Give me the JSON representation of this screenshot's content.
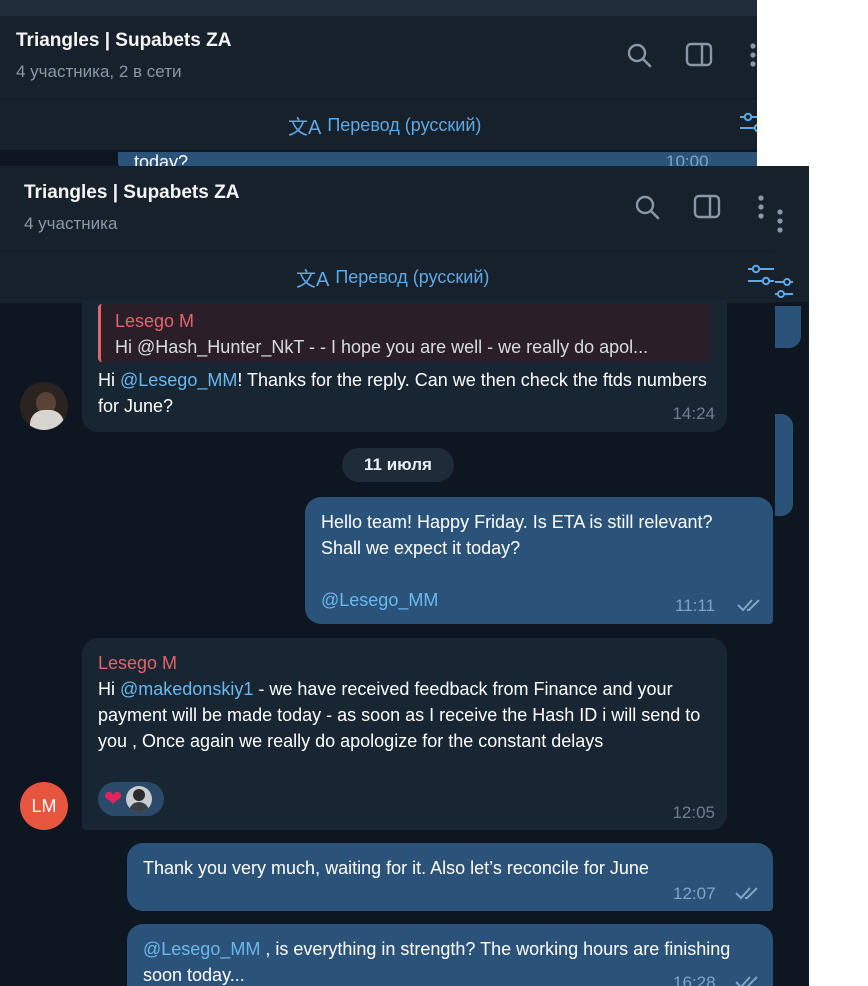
{
  "back_window": {
    "title": "Triangles | Supabets ZA",
    "subtitle": "4 участника, 2 в сети",
    "translate_label": "Перевод (русский)",
    "peek_text": "today?",
    "peek_time": "10:00"
  },
  "front_window": {
    "title": "Triangles | Supabets ZA",
    "subtitle": "4 участника",
    "translate_label": "Перевод (русский)"
  },
  "icons": {
    "search": "search-icon",
    "sidebar": "sidebar-toggle-icon",
    "menu": "more-vertical-icon",
    "filter": "translate-settings-icon",
    "translate": "translate-icon"
  },
  "colors": {
    "bg": "#0e1621",
    "header": "#17212b",
    "incoming": "#182533",
    "outgoing": "#2b5278",
    "link": "#6bb8ee",
    "sender": "#e5646a",
    "accent": "#5fa8e8",
    "avatar_lm": "#e8553f"
  },
  "messages": [
    {
      "reply_name": "Lesego M",
      "reply_text": "Hi @Hash_Hunter_NkT - - I hope you are well - we really do apol...",
      "pre": "Hi ",
      "mention": "@Lesego_MM",
      "post": "! Thanks for the reply. Can we then check the ftds numbers for June?",
      "time": "14:24"
    },
    {
      "text": "Hello team! Happy Friday. Is ETA is still relevant? Shall we expect it today?",
      "mention": "@Lesego_MM",
      "time": "11:11"
    },
    {
      "sender": "Lesego M",
      "pre": "Hi ",
      "mention": "@makedonskiy1",
      "post": " -  we have received feedback from Finance and your payment will be made today - as soon as I receive the Hash ID i will send to you , Once again we really do apologize for the constant delays",
      "time": "12:05",
      "avatar": "LM"
    },
    {
      "text": "Thank you very much, waiting for it. Also let’s reconcile for June",
      "time": "12:07"
    },
    {
      "mention": "@Lesego_MM",
      "post": " , is everything in strength? The working hours are finishing soon today...",
      "time": "16:28"
    }
  ],
  "date_divider": "11 июля"
}
